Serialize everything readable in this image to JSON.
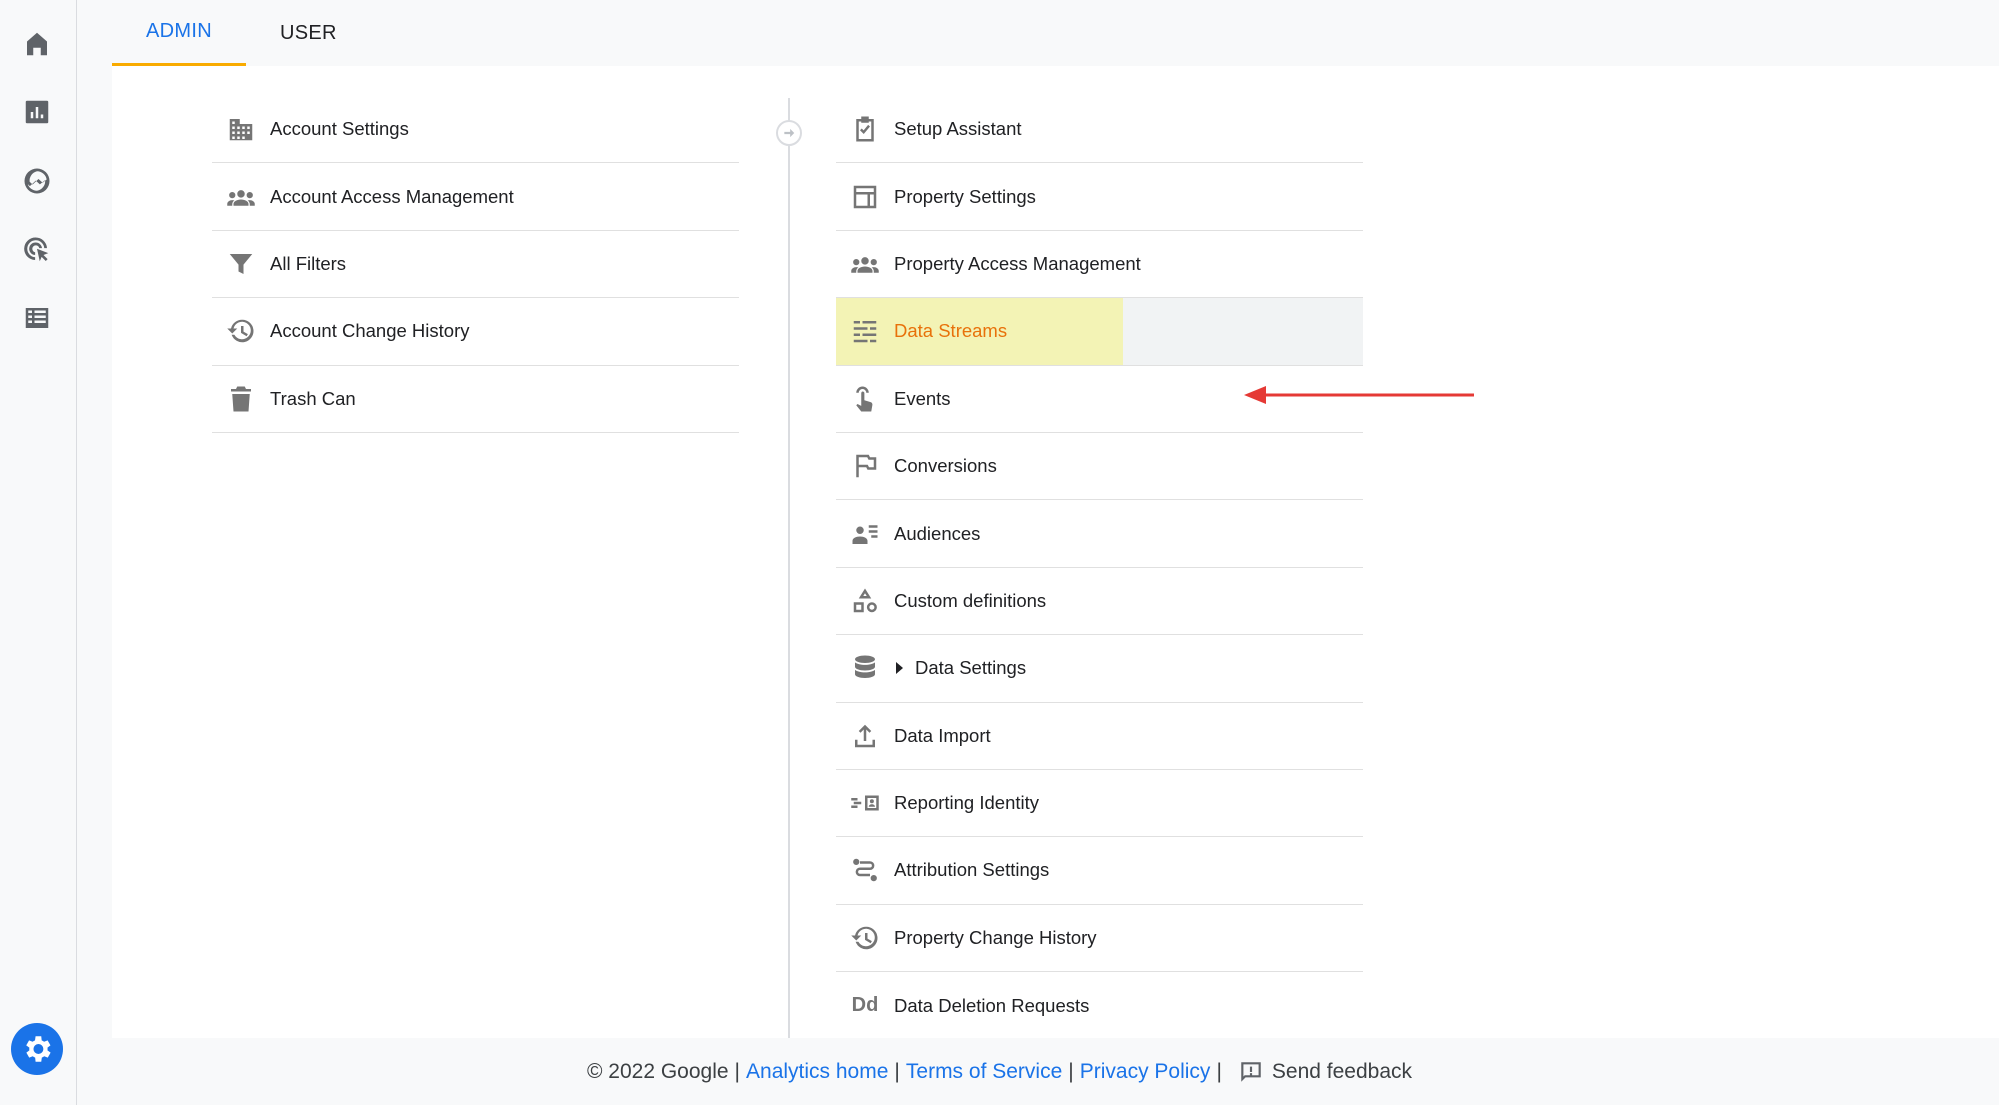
{
  "tabs": {
    "admin": "ADMIN",
    "user": "USER"
  },
  "account_menu": [
    {
      "label": "Account Settings",
      "icon": "building-icon"
    },
    {
      "label": "Account Access Management",
      "icon": "people-icon"
    },
    {
      "label": "All Filters",
      "icon": "filter-icon"
    },
    {
      "label": "Account Change History",
      "icon": "history-icon"
    },
    {
      "label": "Trash Can",
      "icon": "trash-icon"
    }
  ],
  "property_menu": [
    {
      "label": "Setup Assistant",
      "icon": "checklist-icon"
    },
    {
      "label": "Property Settings",
      "icon": "layout-icon"
    },
    {
      "label": "Property Access Management",
      "icon": "people-icon"
    },
    {
      "label": "Data Streams",
      "icon": "streams-icon",
      "highlighted": true
    },
    {
      "label": "Events",
      "icon": "touch-icon"
    },
    {
      "label": "Conversions",
      "icon": "flag-icon"
    },
    {
      "label": "Audiences",
      "icon": "audience-icon"
    },
    {
      "label": "Custom definitions",
      "icon": "shapes-icon"
    },
    {
      "label": "Data Settings",
      "icon": "database-icon"
    },
    {
      "label": "Data Import",
      "icon": "upload-icon"
    },
    {
      "label": "Reporting Identity",
      "icon": "identity-icon"
    },
    {
      "label": "Attribution Settings",
      "icon": "path-icon"
    },
    {
      "label": "Property Change History",
      "icon": "history-icon"
    },
    {
      "label": "Data Deletion Requests",
      "icon": "dd-icon",
      "icon_text": "Dd"
    }
  ],
  "footer": {
    "copyright": "© 2022 Google",
    "sep": "|",
    "analytics_home": "Analytics home",
    "terms": "Terms of Service",
    "privacy": "Privacy Policy",
    "feedback": "Send feedback"
  },
  "colors": {
    "accent": "#1a73e8",
    "highlight": "#f3f3b5",
    "highlight_text": "#e8710a",
    "arrow": "#e53935",
    "tab_underline": "#f9ab00"
  }
}
